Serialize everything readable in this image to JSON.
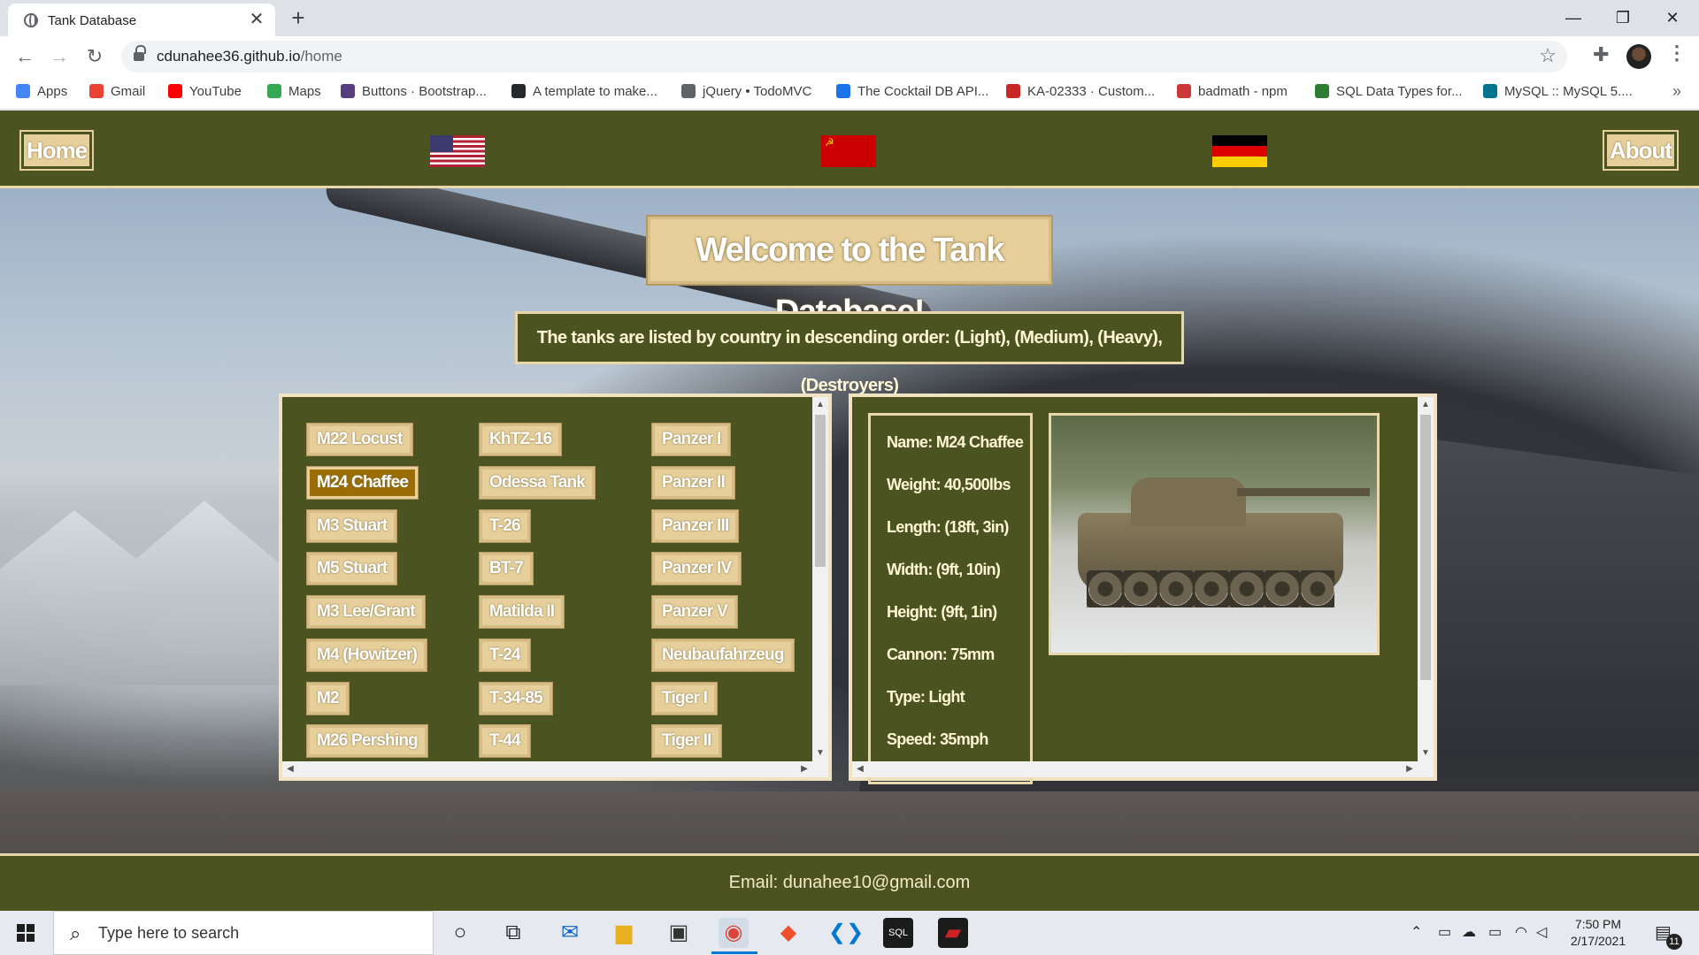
{
  "browser": {
    "tab_title": "Tank Database",
    "tab_close": "✕",
    "new_tab": "+",
    "window_controls": {
      "minimize": "—",
      "maximize": "❐",
      "close": "✕"
    },
    "url_host": "cdunahee36.github.io",
    "url_path": "/home",
    "bookmarks": [
      {
        "label": "Apps",
        "color": "#4285f4"
      },
      {
        "label": "Gmail",
        "color": "#ea4335"
      },
      {
        "label": "YouTube",
        "color": "#ff0000"
      },
      {
        "label": "Maps",
        "color": "#34a853"
      },
      {
        "label": "Buttons · Bootstrap...",
        "color": "#563d7c"
      },
      {
        "label": "A template to make...",
        "color": "#24292e"
      },
      {
        "label": "jQuery • TodoMVC",
        "color": "#5f6368"
      },
      {
        "label": "The Cocktail DB API...",
        "color": "#1a73e8"
      },
      {
        "label": "KA-02333 · Custom...",
        "color": "#c62828"
      },
      {
        "label": "badmath - npm",
        "color": "#cb3837"
      },
      {
        "label": "SQL Data Types for...",
        "color": "#2e7d32"
      },
      {
        "label": "MySQL :: MySQL 5....",
        "color": "#00758f"
      }
    ],
    "bookmarks_more": "»"
  },
  "site": {
    "nav": {
      "home": "Home",
      "about": "About"
    },
    "flags": [
      "usa-flag",
      "ussr-flag",
      "germany-flag"
    ],
    "title": "Welcome to the Tank Database!",
    "subtitle": "The tanks are listed by country in descending order: (Light), (Medium), (Heavy), (Destroyers)",
    "tanks": {
      "usa": [
        "M22 Locust",
        "M24 Chaffee",
        "M3 Stuart",
        "M5 Stuart",
        "M3 Lee/Grant",
        "M4 (Howitzer)",
        "M2",
        "M26 Pershing"
      ],
      "ussr": [
        "KhTZ-16",
        "Odessa Tank",
        "T-26",
        "BT-7",
        "Matilda II",
        "T-24",
        "T-34-85",
        "T-44"
      ],
      "germany": [
        "Panzer I",
        "Panzer II",
        "Panzer III",
        "Panzer IV",
        "Panzer V",
        "Neubaufahrzeug",
        "Tiger I",
        "Tiger II"
      ]
    },
    "selected_tank": "M24 Chaffee",
    "details": {
      "name": "Name: M24 Chaffee",
      "weight": "Weight: 40,500lbs",
      "length": "Length: (18ft, 3in)",
      "width": "Width: (9ft, 10in)",
      "height": "Height: (9ft, 1in)",
      "cannon": "Cannon: 75mm",
      "type": "Type: Light",
      "speed": "Speed: 35mph"
    },
    "footer": "Email: dunahee10@gmail.com"
  },
  "taskbar": {
    "search_placeholder": "Type here to search",
    "time": "7:50 PM",
    "date": "2/17/2021",
    "notifications": "11"
  },
  "colors": {
    "olive": "#4b5320",
    "tan": "#e6cf9b",
    "selected": "#9a6d05"
  }
}
